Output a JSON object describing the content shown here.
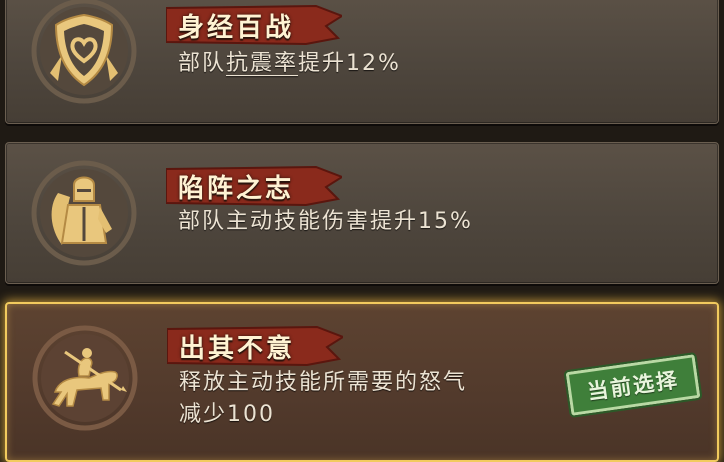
{
  "skills": [
    {
      "title": "身经百战",
      "desc_prefix": "部队",
      "desc_keyword": "抗震率",
      "desc_suffix": "提升12%",
      "icon": "shield-heart-icon"
    },
    {
      "title": "陷阵之志",
      "desc": "部队主动技能伤害提升15%",
      "icon": "armored-knight-icon"
    },
    {
      "title": "出其不意",
      "desc_line1": "释放主动技能所需要的怒气",
      "desc_line2": "减少100",
      "icon": "cavalry-rider-icon",
      "badge": "当前选择"
    }
  ],
  "colors": {
    "panel_bg": "#4e463d",
    "selected_border": "#f2cb5e",
    "icon_gold": "#e9c77d",
    "ribbon_red": "#8a2a1c",
    "badge_green": "#3f7f3a"
  }
}
